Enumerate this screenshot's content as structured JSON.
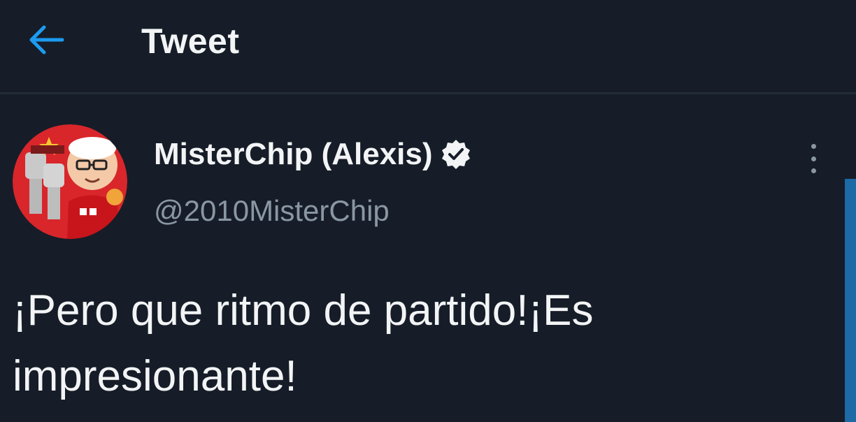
{
  "header": {
    "title": "Tweet",
    "back_icon": "arrow-left-icon"
  },
  "tweet": {
    "author_name": "MisterChip (Alexis)",
    "author_handle": "@2010MisterChip",
    "verified_icon": "verified-badge-icon",
    "more_icon": "more-vertical-icon",
    "text": "¡Pero que ritmo de partido!¡Es\nimpresionante!"
  },
  "colors": {
    "background": "#161d28",
    "accent": "#1d9bf0",
    "secondary_text": "#8a97a3",
    "avatar_bg": "#d9262b"
  }
}
